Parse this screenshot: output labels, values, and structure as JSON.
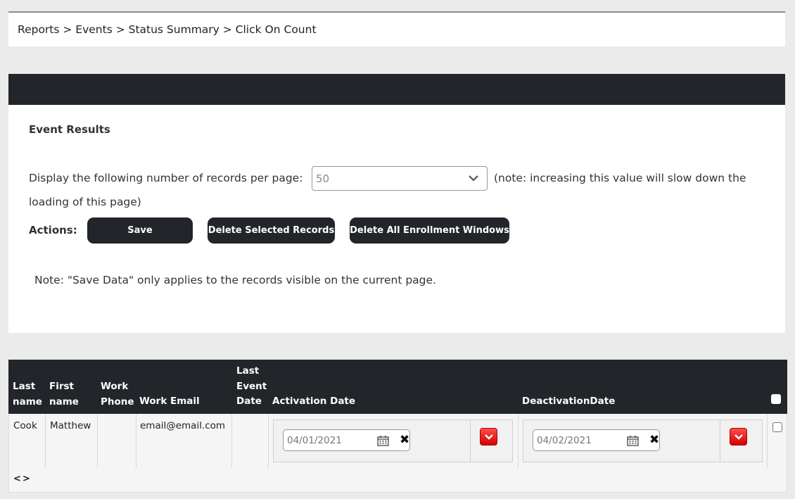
{
  "breadcrumb": "Reports > Events > Status Summary > Click On Count",
  "panel": {
    "title": "Event Results",
    "records_label": "Display the following number of records per page:",
    "records_value": "50",
    "records_note_line1": "(note: increasing this value will slow down the",
    "records_note_line2": "loading of this page)",
    "actions_label": "Actions:",
    "buttons": {
      "save": "Save",
      "delete_selected": "Delete Selected Records",
      "delete_all": "Delete All Enrollment Windows"
    },
    "note": "Note: \"Save Data\" only applies to the records visible on the current page."
  },
  "table": {
    "headers": {
      "last_name_1": "Last",
      "last_name_2": "name",
      "first_name_1": "First",
      "first_name_2": "name",
      "work_phone_1": "Work",
      "work_phone_2": "Phone",
      "work_email": "Work Email",
      "last_event_1": "Last",
      "last_event_2": "Event",
      "last_event_3": "Date",
      "activation": "Activation Date",
      "deactivation": "DeactivationDate"
    },
    "rows": [
      {
        "last_name": "Cook",
        "first_name": "Matthew",
        "work_phone": "",
        "work_email": "email@email.com",
        "last_event_date": "",
        "activation_date": "04/01/2021",
        "deactivation_date": "04/02/2021"
      }
    ],
    "pager": "<>"
  },
  "colors": {
    "dark": "#222529",
    "accent_red": "#e60000"
  },
  "icons": [
    "chevron-down-icon",
    "calendar-icon",
    "clear-x-icon",
    "dropdown-red-icon",
    "checkbox"
  ]
}
